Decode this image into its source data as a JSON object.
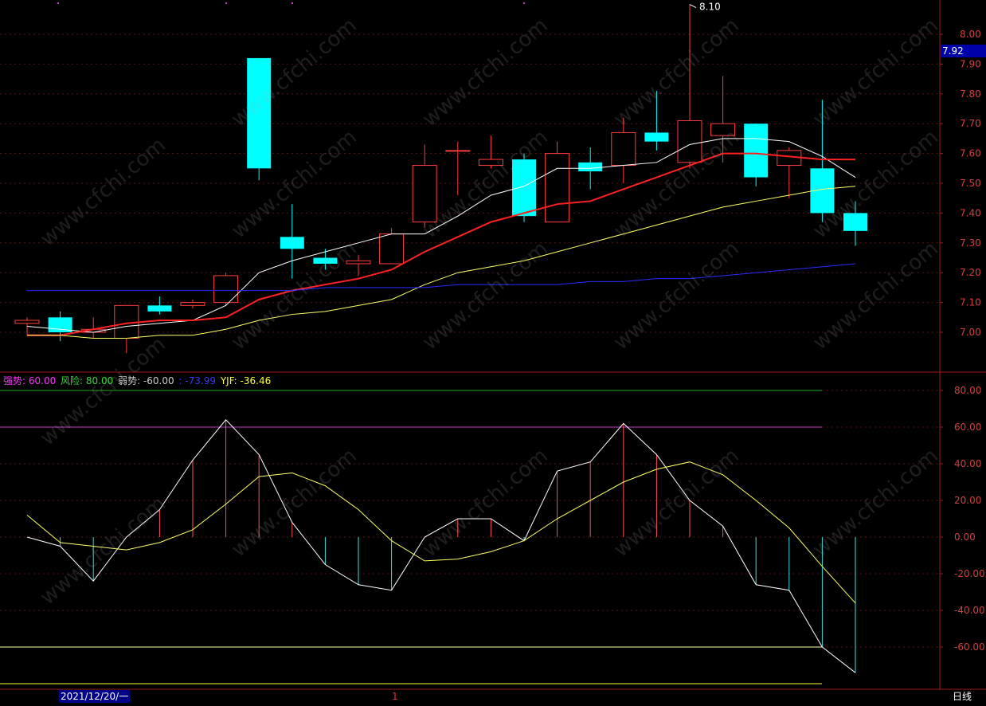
{
  "chart_data": [
    {
      "type": "candlestick",
      "ylim": [
        6.88,
        8.12
      ],
      "y_ticks": [
        "8.00",
        "7.90",
        "7.80",
        "7.70",
        "7.60",
        "7.50",
        "7.40",
        "7.30",
        "7.20",
        "7.10",
        "7.00"
      ],
      "current_price": "7.92",
      "max_label": "8.10",
      "candles": [
        {
          "o": 7.03,
          "h": 7.05,
          "l": 6.99,
          "c": 7.04
        },
        {
          "o": 7.05,
          "h": 7.07,
          "l": 6.97,
          "c": 7.0
        },
        {
          "o": 7.0,
          "h": 7.05,
          "l": 6.98,
          "c": 7.01
        },
        {
          "o": 6.98,
          "h": 7.09,
          "l": 6.93,
          "c": 7.09
        },
        {
          "o": 7.09,
          "h": 7.12,
          "l": 7.06,
          "c": 7.07
        },
        {
          "o": 7.09,
          "h": 7.11,
          "l": 7.08,
          "c": 7.1
        },
        {
          "o": 7.1,
          "h": 7.2,
          "l": 7.09,
          "c": 7.19
        },
        {
          "o": 7.92,
          "h": 7.92,
          "l": 7.51,
          "c": 7.55
        },
        {
          "o": 7.32,
          "h": 7.43,
          "l": 7.18,
          "c": 7.28
        },
        {
          "o": 7.25,
          "h": 7.28,
          "l": 7.21,
          "c": 7.23
        },
        {
          "o": 7.23,
          "h": 7.26,
          "l": 7.19,
          "c": 7.24
        },
        {
          "o": 7.23,
          "h": 7.35,
          "l": 7.23,
          "c": 7.33
        },
        {
          "o": 7.37,
          "h": 7.63,
          "l": 7.35,
          "c": 7.56
        },
        {
          "o": 7.61,
          "h": 7.64,
          "l": 7.46,
          "c": 7.61
        },
        {
          "o": 7.56,
          "h": 7.66,
          "l": 7.55,
          "c": 7.58
        },
        {
          "o": 7.58,
          "h": 7.6,
          "l": 7.37,
          "c": 7.39
        },
        {
          "o": 7.37,
          "h": 7.64,
          "l": 7.37,
          "c": 7.6
        },
        {
          "o": 7.57,
          "h": 7.62,
          "l": 7.48,
          "c": 7.54
        },
        {
          "o": 7.56,
          "h": 7.72,
          "l": 7.5,
          "c": 7.67
        },
        {
          "o": 7.67,
          "h": 7.81,
          "l": 7.61,
          "c": 7.64
        },
        {
          "o": 7.57,
          "h": 8.1,
          "l": 7.55,
          "c": 7.71
        },
        {
          "o": 7.66,
          "h": 7.86,
          "l": 7.57,
          "c": 7.7
        },
        {
          "o": 7.7,
          "h": 7.7,
          "l": 7.49,
          "c": 7.52
        },
        {
          "o": 7.56,
          "h": 7.62,
          "l": 7.45,
          "c": 7.61
        },
        {
          "o": 7.55,
          "h": 7.78,
          "l": 7.37,
          "c": 7.4
        },
        {
          "o": 7.4,
          "h": 7.44,
          "l": 7.29,
          "c": 7.34
        }
      ],
      "ma_lines": [
        {
          "color": "#ffffff",
          "values": [
            7.02,
            7.01,
            7.0,
            7.02,
            7.03,
            7.04,
            7.09,
            7.2,
            7.24,
            7.27,
            7.3,
            7.33,
            7.33,
            7.39,
            7.46,
            7.49,
            7.55,
            7.55,
            7.56,
            7.57,
            7.63,
            7.65,
            7.65,
            7.64,
            7.59,
            7.52
          ]
        },
        {
          "color": "#ff2020",
          "values": [
            6.99,
            6.99,
            7.01,
            7.03,
            7.04,
            7.04,
            7.05,
            7.11,
            7.14,
            7.16,
            7.18,
            7.21,
            7.27,
            7.32,
            7.37,
            7.4,
            7.43,
            7.44,
            7.48,
            7.52,
            7.56,
            7.6,
            7.6,
            7.59,
            7.58,
            7.58
          ]
        },
        {
          "color": "#ffff66",
          "values": [
            6.99,
            6.99,
            6.98,
            6.98,
            6.99,
            6.99,
            7.01,
            7.04,
            7.06,
            7.07,
            7.09,
            7.11,
            7.16,
            7.2,
            7.22,
            7.24,
            7.27,
            7.3,
            7.33,
            7.36,
            7.39,
            7.42,
            7.44,
            7.46,
            7.48,
            7.49
          ]
        },
        {
          "color": "#2a2aff",
          "values": [
            7.14,
            7.14,
            7.14,
            7.14,
            7.14,
            7.14,
            7.14,
            7.14,
            7.14,
            7.15,
            7.15,
            7.15,
            7.15,
            7.16,
            7.16,
            7.16,
            7.16,
            7.17,
            7.17,
            7.18,
            7.18,
            7.19,
            7.2,
            7.21,
            7.22,
            7.23
          ]
        }
      ]
    },
    {
      "type": "line",
      "ylim": [
        -80,
        100
      ],
      "y_ticks": [
        "80.00",
        "60.00",
        "40.00",
        "20.00",
        "0.00",
        "-20.00",
        "-40.00",
        "-60.00"
      ],
      "legend": [
        {
          "label": "强势: 60.00",
          "color": "#ff33ff"
        },
        {
          "label": "风险: 80.00",
          "color": "#33dd33"
        },
        {
          "label": "弱势: -60.00",
          "color": "#cccccc"
        },
        {
          "label": ": -73.99",
          "color": "#3a3aff"
        },
        {
          "label": "YJF: -36.46",
          "color": "#ffff33"
        }
      ],
      "reference_lines": [
        {
          "value": 80,
          "color": "#22aa22"
        },
        {
          "value": 60,
          "color": "#cc33cc"
        },
        {
          "value": -60,
          "color": "#ffffaa"
        },
        {
          "value": -80,
          "color": "#ffff33"
        }
      ],
      "series": [
        {
          "color": "#ffffff",
          "values": [
            0,
            -5,
            -24,
            0,
            15,
            42,
            64,
            45,
            8,
            -15,
            -26,
            -29,
            0,
            10,
            10,
            -2,
            36,
            41,
            62,
            45,
            20,
            6,
            -26,
            -29,
            -60,
            -74
          ]
        },
        {
          "color": "#ffff66",
          "values": [
            12,
            -3,
            -5,
            -7,
            -3,
            4,
            18,
            33,
            35,
            28,
            15,
            -2,
            -13,
            -12,
            -8,
            -2,
            10,
            20,
            30,
            37,
            41,
            34,
            20,
            5,
            -16,
            -36
          ]
        }
      ]
    }
  ],
  "footer": {
    "date": "2021/12/20/一",
    "cursor_index": "1",
    "period": "日线"
  },
  "watermark": "www.cfchi.com"
}
